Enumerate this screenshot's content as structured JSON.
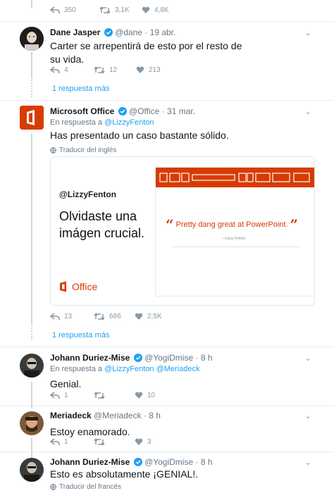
{
  "top_actions": {
    "reply": "",
    "retweets": "350",
    "retweets2": "3,1K",
    "likes": "4,8K"
  },
  "tweets": [
    {
      "name": "Dane Jasper",
      "handle": "@dane",
      "time": "19 abr.",
      "text": "Carter se arrepentirá de esto por el resto de su vida.",
      "replies": "4",
      "retweets": "12",
      "likes": "213"
    },
    {
      "name": "Microsoft Office",
      "handle": "@Office",
      "time": "31 mar.",
      "replying_prefix": "En respuesta a",
      "replying_to": "@LizzyFenton",
      "text": "Has presentado un caso bastante sólido.",
      "translate": "Traducir del inglés",
      "replies": "13",
      "retweets": "686",
      "likes": "2,5K",
      "card": {
        "handle": "@LizzyFenton",
        "quote": "Olvidaste una imágen crucial.",
        "brand": "Office",
        "slide_quote": "Pretty dang great at PowerPoint.",
        "slide_author": "—Lizzy Fenton"
      }
    },
    {
      "name": "Johann Duriez-Mise",
      "handle": "@YogiDmise",
      "time": "8 h",
      "replying_prefix": "En respuesta a",
      "replying_to": "@LizzyFenton @Meriadeck",
      "text": "Genial.",
      "replies": "1",
      "retweets": "",
      "likes": "10"
    },
    {
      "name": "Meriadeck",
      "handle": "@Meriadeck",
      "time": "8 h",
      "text": "Estoy enamorado.",
      "replies": "1",
      "retweets": "",
      "likes": "3"
    },
    {
      "name": "Johann Duriez-Mise",
      "handle": "@YogiDmise",
      "time": "8 h",
      "text": "Esto es absolutamente ¡GENIAL!.",
      "translate": "Traducir del francés"
    }
  ],
  "more_replies_1": "1 respuesta más",
  "more_replies_2": "1 respuesta más",
  "dot": "·",
  "colors": {
    "link": "#1da1f2",
    "office": "#d83b01",
    "muted": "#657786",
    "divider": "#e6ecf0"
  }
}
